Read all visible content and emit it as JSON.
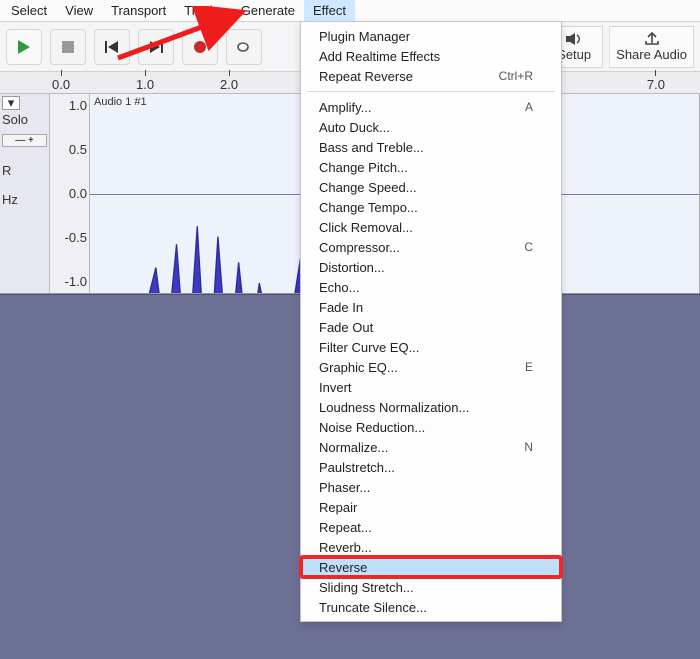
{
  "menu": {
    "items": [
      "Select",
      "View",
      "Transport",
      "Tracks",
      "Generate",
      "Effect"
    ],
    "active_index": 5
  },
  "toolbar": {
    "setup_label": "Setup",
    "share_label": "Share Audio"
  },
  "ruler": {
    "ticks": [
      "0.0",
      "1.0",
      "2.0"
    ],
    "right_tick": "7.0"
  },
  "track": {
    "title": "Audio 1 #1",
    "solo_label": "Solo",
    "r_label": "R",
    "hz_label": "Hz",
    "scale": [
      "1.0",
      "0.5",
      "0.0",
      "-0.5",
      "-1.0"
    ]
  },
  "effects_menu": {
    "top": [
      {
        "label": "Plugin Manager",
        "accel": ""
      },
      {
        "label": "Add Realtime Effects",
        "accel": ""
      },
      {
        "label": "Repeat Reverse",
        "accel": "Ctrl+R"
      }
    ],
    "items": [
      {
        "label": "Amplify...",
        "accel": "A"
      },
      {
        "label": "Auto Duck...",
        "accel": ""
      },
      {
        "label": "Bass and Treble...",
        "accel": ""
      },
      {
        "label": "Change Pitch...",
        "accel": ""
      },
      {
        "label": "Change Speed...",
        "accel": ""
      },
      {
        "label": "Change Tempo...",
        "accel": ""
      },
      {
        "label": "Click Removal...",
        "accel": ""
      },
      {
        "label": "Compressor...",
        "accel": "C"
      },
      {
        "label": "Distortion...",
        "accel": ""
      },
      {
        "label": "Echo...",
        "accel": ""
      },
      {
        "label": "Fade In",
        "accel": ""
      },
      {
        "label": "Fade Out",
        "accel": ""
      },
      {
        "label": "Filter Curve EQ...",
        "accel": ""
      },
      {
        "label": "Graphic EQ...",
        "accel": "E"
      },
      {
        "label": "Invert",
        "accel": ""
      },
      {
        "label": "Loudness Normalization...",
        "accel": ""
      },
      {
        "label": "Noise Reduction...",
        "accel": ""
      },
      {
        "label": "Normalize...",
        "accel": "N"
      },
      {
        "label": "Paulstretch...",
        "accel": ""
      },
      {
        "label": "Phaser...",
        "accel": ""
      },
      {
        "label": "Repair",
        "accel": ""
      },
      {
        "label": "Repeat...",
        "accel": ""
      },
      {
        "label": "Reverb...",
        "accel": ""
      },
      {
        "label": "Reverse",
        "accel": "",
        "selected": true,
        "highlight": true
      },
      {
        "label": "Sliding Stretch...",
        "accel": ""
      },
      {
        "label": "Truncate Silence...",
        "accel": ""
      }
    ]
  }
}
